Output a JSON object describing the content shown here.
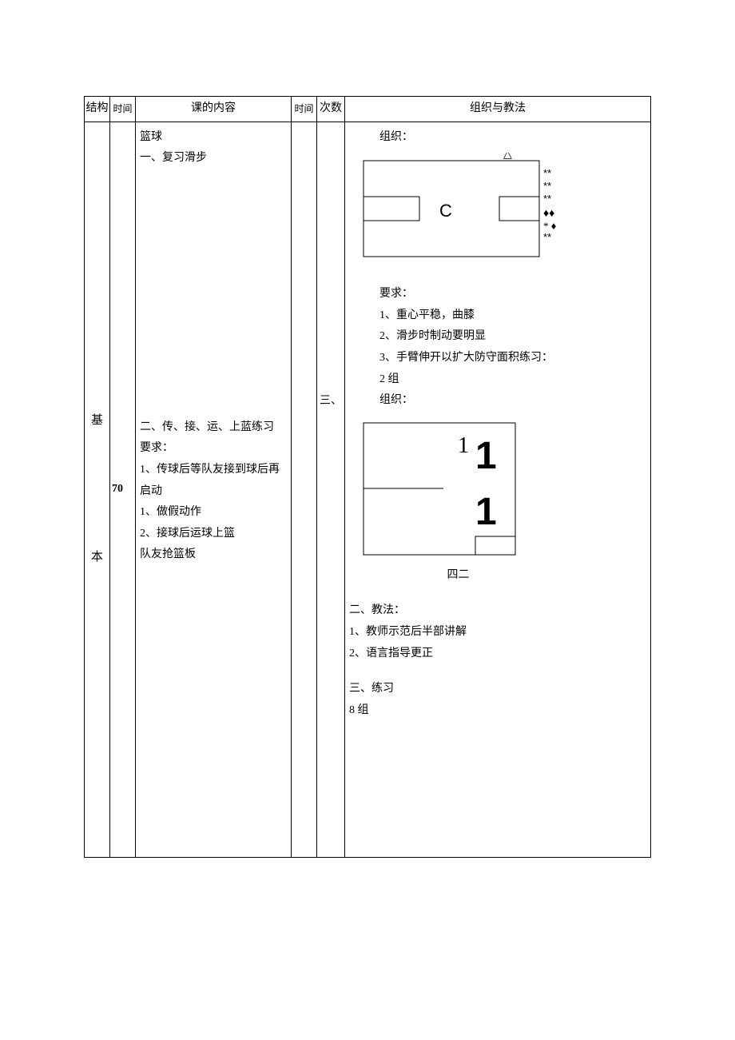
{
  "headers": {
    "structure": "结构",
    "time1": "时间",
    "content": "课的内容",
    "time2": "时间",
    "count": "次数",
    "method": "组织与教法"
  },
  "body": {
    "structure_label": "基本",
    "time1_value": "70",
    "count_value": "三、",
    "content": {
      "title": "篮球",
      "section1": "一、复习滑步",
      "section2_title": "二、传、接、运、上蓝练习",
      "section2_req_label": "要求：",
      "section2_req1": "1、传球后等队友接到球后再启动",
      "section2_req2": "1、做假动作",
      "section2_req3": "2、接球后运球上篮",
      "section2_req4": "队友抢篮板"
    },
    "method": {
      "org1_label": "组织：",
      "court1": {
        "triangle": "△",
        "stars_r1": "**",
        "stars_r2": "**",
        "stars_r3": "**",
        "diamonds": "♦♦",
        "star_diamond": "*♦",
        "stars_r4": "**",
        "center": "C"
      },
      "req_label": "要求：",
      "req1": "1、重心平稳，曲膝",
      "req2": "2、滑步时制动要明显",
      "req3": "3、手臂伸开以扩大防守面积练习：",
      "practice1_sets": "2 组",
      "org2_label": "组织：",
      "court2": {
        "num1": "1",
        "num2": "1",
        "num3": "1",
        "below": "四二"
      },
      "method2_label": "二、教法：",
      "method2_item1": "1、教师示范后半部讲解",
      "method2_item2": "2、语言指导更正",
      "practice2_label": "三、练习",
      "practice2_sets": "8 组"
    }
  }
}
